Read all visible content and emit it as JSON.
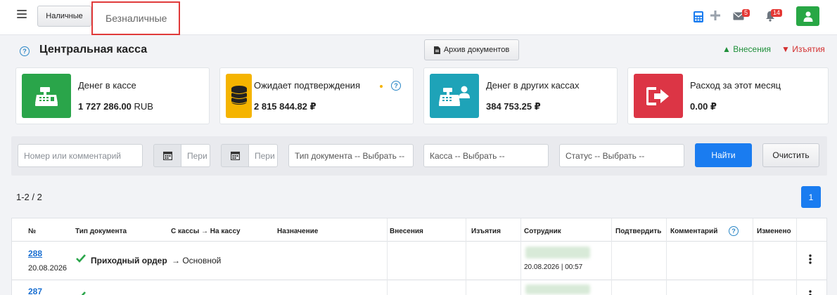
{
  "topbar": {
    "tab_cash": "Наличные",
    "tab_bank": "Безналичные",
    "mail_count": "5",
    "bell_count": "14"
  },
  "header": {
    "title": "Центральная касса",
    "archive_label": "Архив документов",
    "legend_in": "Внесения",
    "legend_out": "Изъятия"
  },
  "cards": [
    {
      "title": "Денег в кассе",
      "value": "1 727 286.00",
      "unit": "RUB",
      "color": "#2aa54a"
    },
    {
      "title": "Ожидает подтверждения",
      "value": "2 815 844.82 ₽",
      "color": "#f5b400"
    },
    {
      "title": "Денег в других кассах",
      "value": "384 753.25 ₽",
      "color": "#1ea3b8"
    },
    {
      "title": "Расход за этот месяц",
      "value": "0.00 ₽",
      "color": "#dc3545"
    }
  ],
  "filters": {
    "number_placeholder": "Номер или комментарий",
    "date_from_placeholder": "Пери",
    "date_to_placeholder": "Пери",
    "doc_type": "Тип документа -- Выбрать --",
    "cashbox": "Касса -- Выбрать --",
    "status": "Статус -- Выбрать --",
    "find_label": "Найти",
    "clear_label": "Очистить"
  },
  "pager": {
    "info": "1-2 / 2",
    "current_page": "1"
  },
  "table": {
    "headers": [
      "№",
      "Тип документа",
      "С кассы → На кассу",
      "Назначение",
      "Внесения",
      "Изъятия",
      "Сотрудник",
      "Подтвердить",
      "Комментарий",
      "Изменено"
    ],
    "rows": [
      {
        "number": "288",
        "date": "20.08.2026",
        "type": "Приходный ордер",
        "route": "→ Основной",
        "employee_time": "20.08.2026 | 00:57"
      },
      {
        "number": "287"
      }
    ]
  },
  "colors": {
    "accent": "#1a7cf0",
    "highlight": "#e03a3a",
    "income": "#1f8f3a",
    "outcome": "#d32f2f"
  }
}
